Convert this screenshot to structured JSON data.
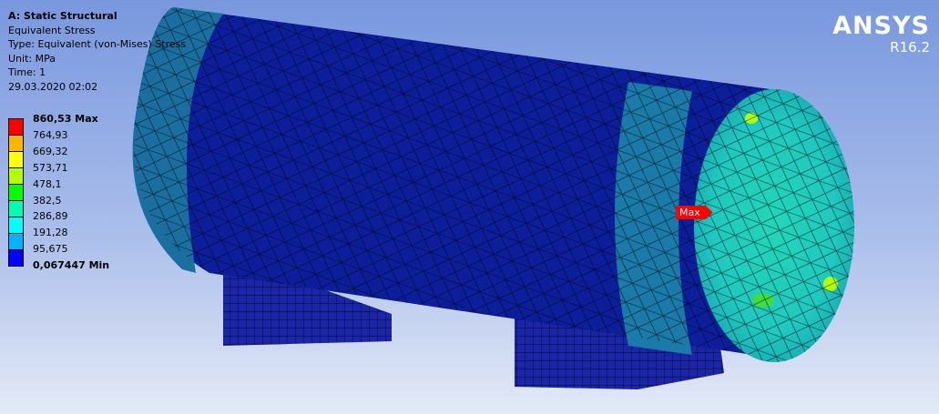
{
  "header": {
    "title": "A: Static Structural",
    "result": "Equivalent Stress",
    "type": "Type: Equivalent (von-Mises) Stress",
    "unit": "Unit: MPa",
    "time": "Time: 1",
    "date": "29.03.2020 02:02"
  },
  "legend": {
    "labels": [
      "860,53 Max",
      "764,93",
      "669,32",
      "573,71",
      "478,1",
      "382,5",
      "286,89",
      "191,28",
      "95,675",
      "0,067447 Min"
    ],
    "colors": [
      "#ff0000",
      "#ffb400",
      "#ffff00",
      "#b4ff00",
      "#00ff00",
      "#00ffb4",
      "#00ffff",
      "#00b4ff",
      "#0000ff"
    ]
  },
  "brand": {
    "name": "ANSYS",
    "version": "R16.2"
  },
  "probe": {
    "max_label": "Max"
  }
}
